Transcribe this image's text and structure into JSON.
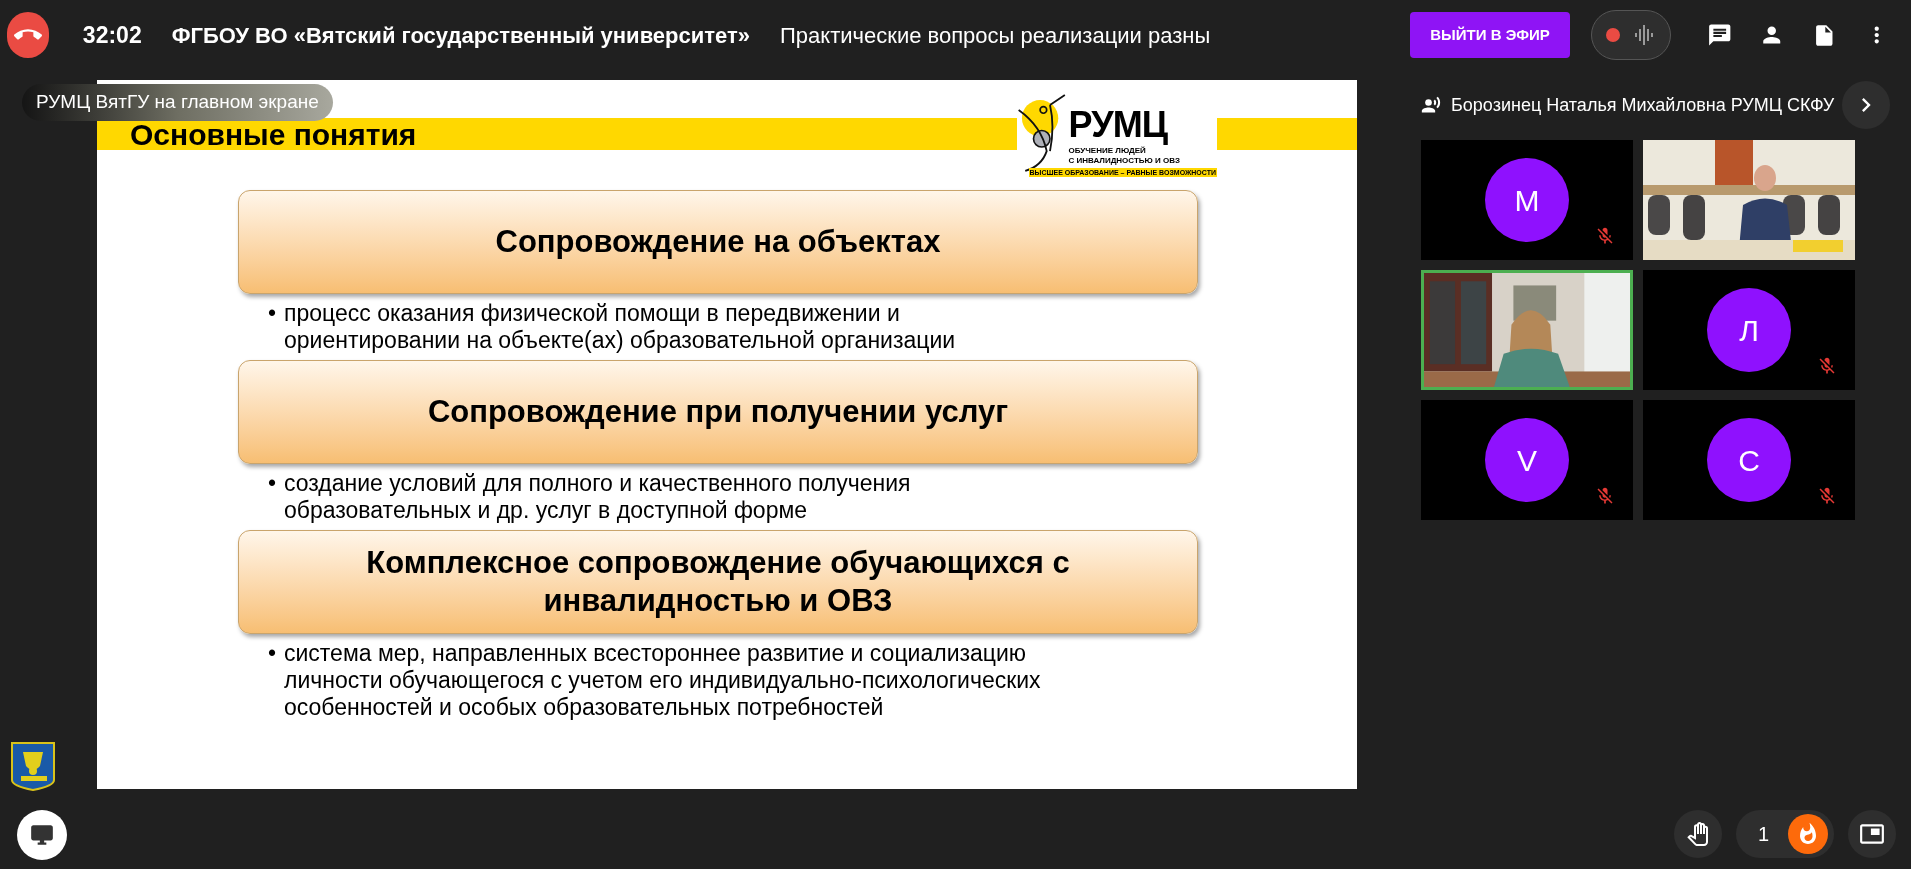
{
  "top_bar": {
    "timer": "32:02",
    "organization": "ФГБОУ ВО «Вятский государственный университет»",
    "event_title": "Практические вопросы реализации разны",
    "broadcast_button": "ВЫЙТИ В ЭФИР",
    "recording": true
  },
  "screen_label": "РУМЦ ВятГУ на главном экране",
  "slide": {
    "title": "Основные понятия",
    "logo": {
      "name": "РУМЦ",
      "line_1": "ОБУЧЕНИЕ ЛЮДЕЙ",
      "line_2": "С ИНВАЛИДНОСТЬЮ И ОВЗ",
      "tagline": "ВЫСШЕЕ ОБРАЗОВАНИЕ – РАВНЫЕ ВОЗМОЖНОСТИ"
    },
    "sections": [
      {
        "heading": "Сопровождение на объектах",
        "marker": "•",
        "description": "процесс оказания физической помощи в передвижении и ориентировании на объекте(ах) образовательной организации"
      },
      {
        "heading": "Сопровождение при получении услуг",
        "marker": "•",
        "description": "создание условий для полного и качественного получения образовательных и др. услуг в доступной форме"
      },
      {
        "heading": "Комплексное сопровождение обучающихся с инвалидностью и ОВЗ",
        "marker": "•",
        "description": "система мер, направленных всестороннее развитие и социализацию личности обучающегося с учетом его индивидуально-психологических особенностей и особых образовательных потребностей"
      }
    ]
  },
  "speaker": {
    "name": "Борозинец Наталья Михайловна РУМЦ СКФУ"
  },
  "participants": [
    {
      "kind": "avatar",
      "initial": "М",
      "muted": true,
      "speaking": false
    },
    {
      "kind": "video",
      "muted": false,
      "speaking": false
    },
    {
      "kind": "video",
      "muted": false,
      "speaking": true
    },
    {
      "kind": "avatar",
      "initial": "Л",
      "muted": true,
      "speaking": false
    },
    {
      "kind": "avatar",
      "initial": "V",
      "muted": true,
      "speaking": false
    },
    {
      "kind": "avatar",
      "initial": "С",
      "muted": true,
      "speaking": false
    }
  ],
  "reactions": {
    "count": "1"
  }
}
